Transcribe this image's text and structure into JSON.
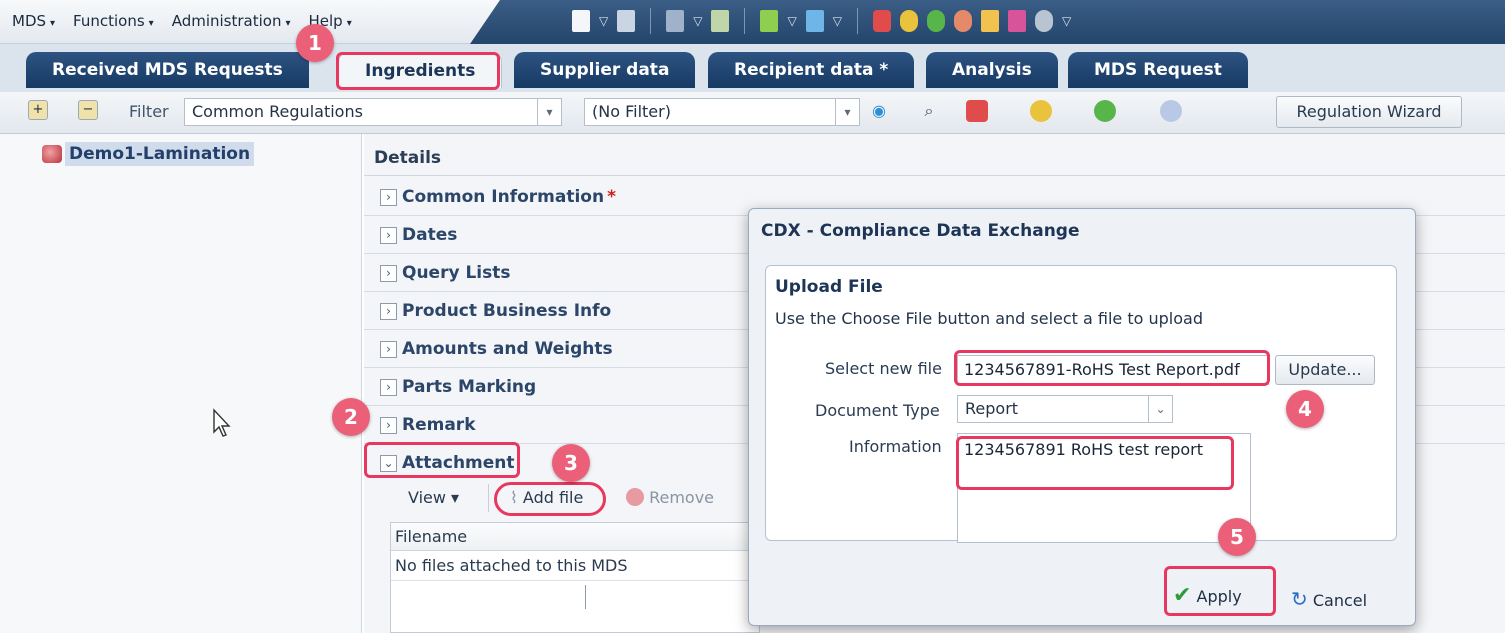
{
  "menu": {
    "items": [
      {
        "label": "MDS"
      },
      {
        "label": "Functions"
      },
      {
        "label": "Administration"
      },
      {
        "label": "Help"
      }
    ]
  },
  "tabs": [
    {
      "label": "Received MDS Requests"
    },
    {
      "label": "Ingredients"
    },
    {
      "label": "Supplier data"
    },
    {
      "label": "Recipient data *"
    },
    {
      "label": "Analysis"
    },
    {
      "label": "MDS Request"
    }
  ],
  "filter": {
    "label": "Filter",
    "regulation_value": "Common Regulations",
    "second_value": "(No Filter)",
    "wizard_label": "Regulation Wizard"
  },
  "tree": {
    "root_label": "Demo1-Lamination"
  },
  "details": {
    "title": "Details",
    "sections": [
      {
        "label": "Common Information",
        "required": "*",
        "state": "collapsed"
      },
      {
        "label": "Dates",
        "state": "collapsed"
      },
      {
        "label": "Query Lists",
        "state": "collapsed"
      },
      {
        "label": "Product Business Info",
        "state": "collapsed"
      },
      {
        "label": "Amounts and Weights",
        "state": "collapsed"
      },
      {
        "label": "Parts Marking",
        "state": "collapsed"
      },
      {
        "label": "Remark",
        "state": "collapsed"
      },
      {
        "label": "Attachment",
        "state": "expanded"
      }
    ],
    "attachment": {
      "view_label": "View",
      "add_label": "Add file",
      "remove_label": "Remove",
      "column_header": "Filename",
      "empty_text": "No files attached to this MDS"
    }
  },
  "dialog": {
    "title": "CDX - Compliance Data Exchange",
    "panel_title": "Upload File",
    "description": "Use the Choose File button and select a file to upload",
    "select_file_label": "Select new file",
    "select_file_value": "1234567891-RoHS Test Report.pdf",
    "update_label": "Update...",
    "doc_type_label": "Document Type",
    "doc_type_value": "Report",
    "info_label": "Information",
    "info_value": "1234567891 RoHS test report",
    "apply_label": "Apply",
    "cancel_label": "Cancel"
  },
  "callouts": [
    "1",
    "2",
    "3",
    "4",
    "5"
  ],
  "colors": {
    "highlight": "#e8385f",
    "badge": "#ec5f79",
    "tab_dark": "#1f4470",
    "accent_green": "#2f9a3a"
  }
}
